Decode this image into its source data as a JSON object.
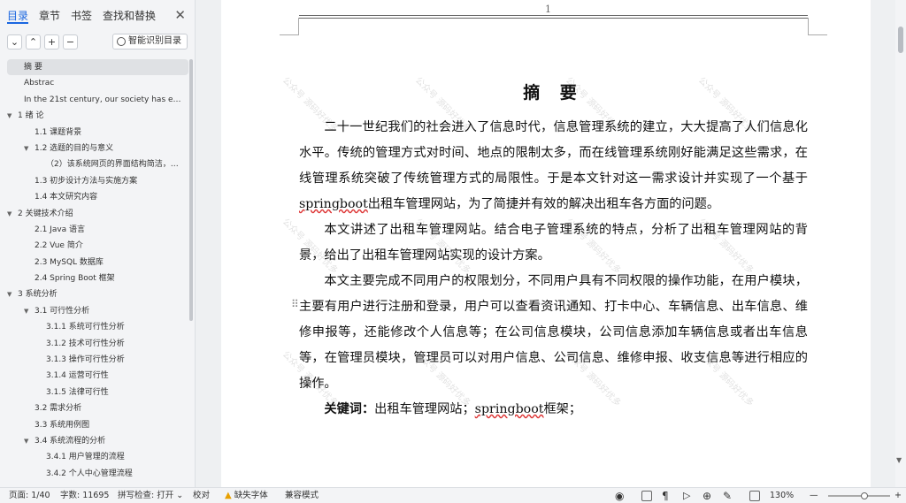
{
  "nav": {
    "tabs": [
      "目录",
      "章节",
      "书签",
      "查找和替换"
    ],
    "close": "✕",
    "tools": [
      "⌄",
      "⌃",
      "+",
      "−"
    ],
    "smart_toc": "智能识别目录",
    "items": [
      {
        "label": "摘  要",
        "level": 0,
        "caret": "",
        "selected": true
      },
      {
        "label": "Abstrac",
        "level": 0,
        "caret": ""
      },
      {
        "label": "In the 21st century, our society has ente...",
        "level": 0,
        "caret": ""
      },
      {
        "label": "1 绪  论",
        "level": 0,
        "caret": "▼"
      },
      {
        "label": "1.1  课题背景",
        "level": 1,
        "caret": ""
      },
      {
        "label": "1.2  选题的目的与意义",
        "level": 1,
        "caret": "▼"
      },
      {
        "label": "（2）该系统网页的界面结构简洁，便...",
        "level": 2,
        "caret": ""
      },
      {
        "label": "1.3  初步设计方法与实施方案",
        "level": 1,
        "caret": ""
      },
      {
        "label": "1.4  本文研究内容",
        "level": 1,
        "caret": ""
      },
      {
        "label": "2  关键技术介绍",
        "level": 0,
        "caret": "▼"
      },
      {
        "label": "2.1 Java 语言",
        "level": 1,
        "caret": ""
      },
      {
        "label": "2.2 Vue 简介",
        "level": 1,
        "caret": ""
      },
      {
        "label": "2.3    MySQL 数据库",
        "level": 1,
        "caret": ""
      },
      {
        "label": "2.4 Spring Boot 框架",
        "level": 1,
        "caret": ""
      },
      {
        "label": "3  系统分析",
        "level": 0,
        "caret": "▼"
      },
      {
        "label": "3.1 可行性分析",
        "level": 1,
        "caret": "▼"
      },
      {
        "label": "3.1.1  系统可行性分析",
        "level": 2,
        "caret": ""
      },
      {
        "label": "3.1.2    技术可行性分析",
        "level": 2,
        "caret": ""
      },
      {
        "label": "3.1.3  操作可行性分析",
        "level": 2,
        "caret": ""
      },
      {
        "label": "3.1.4  运营可行性",
        "level": 2,
        "caret": ""
      },
      {
        "label": "3.1.5  法律可行性",
        "level": 2,
        "caret": ""
      },
      {
        "label": "3.2  需求分析",
        "level": 1,
        "caret": ""
      },
      {
        "label": "3.3 系统用例图",
        "level": 1,
        "caret": ""
      },
      {
        "label": "3.4 系统流程的分析",
        "level": 1,
        "caret": "▼"
      },
      {
        "label": "3.4.1  用户管理的流程",
        "level": 2,
        "caret": ""
      },
      {
        "label": "3.4.2  个人中心管理流程",
        "level": 2,
        "caret": ""
      }
    ]
  },
  "doc": {
    "page_number": "1",
    "title": "摘  要",
    "p1_a": "二十一世纪我们的社会进入了信息时代，信息管理系统的建立，大大提高了人们信息化水平。传统的管理方式对时间、地点的限制太多，而在线管理系统刚好能满足这些需求，在线管理系统突破了传统管理方式的局限性。于是本文针对这一需求设计并实现了一个基于",
    "p1_kw": "springboot",
    "p1_b": "出租车管理网站，为了简捷并有效的解决出租车各方面的问题。",
    "p2": "本文讲述了出租车管理网站。结合电子管理系统的特点，分析了出租车管理网站的背景，给出了出租车管理网站实现的设计方案。",
    "p3": "本文主要完成不同用户的权限划分，不同用户具有不同权限的操作功能，在用户模块，主要有用户进行注册和登录，用户可以查看资讯通知、打卡中心、车辆信息、出车信息、维修申报等，还能修改个人信息等；在公司信息模块，公司信息添加车辆信息或者出车信息等，在管理员模块，管理员可以对用户信息、公司信息、维修申报、收支信息等进行相应的操作。",
    "kw_label": "关键词：",
    "kw_a": "出租车管理网站；",
    "kw_b": "springboot",
    "kw_c": "框架；",
    "watermark": "公众号 源码好优多"
  },
  "status": {
    "page": "页面: 1/40",
    "words": "字数: 11695",
    "spell": "拼写检查: 打开 ⌄",
    "proof": "校对",
    "missing_font": "缺失字体",
    "compat": "兼容模式",
    "zoom": "130%",
    "zoom_minus": "—",
    "zoom_plus": "+",
    "zoom_level": 0.58
  }
}
